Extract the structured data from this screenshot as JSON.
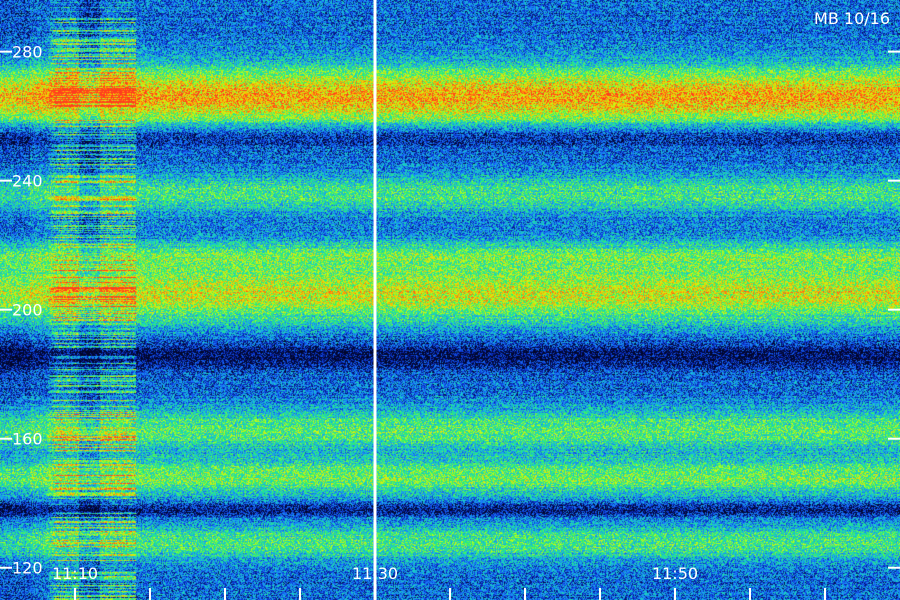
{
  "chart_data": {
    "type": "heatmap",
    "title": "MB 10/16",
    "y_ticks": [
      "120",
      "160",
      "200",
      "240",
      "280"
    ],
    "ylim": [
      110,
      296
    ],
    "x_tick_labels": [
      "11:10",
      "11:30",
      "11:50"
    ],
    "xlim": [
      "11:05",
      "12:05"
    ],
    "x_minor_step_minutes": 5,
    "marker_time": "11:30",
    "colormap": [
      "#02062a",
      "#0a2ecc",
      "#1a7cff",
      "#19d2c8",
      "#2ff06a",
      "#c8ff14",
      "#ffb400",
      "#ff3c1e"
    ],
    "emission_bands": [
      {
        "freq_center": 266,
        "width": 10,
        "strength": 0.62
      },
      {
        "freq_center": 205,
        "width": 9,
        "strength": 0.5
      },
      {
        "freq_center": 236,
        "width": 6,
        "strength": 0.3
      },
      {
        "freq_center": 217,
        "width": 5,
        "strength": 0.28
      },
      {
        "freq_center": 163,
        "width": 7,
        "strength": 0.32
      },
      {
        "freq_center": 148,
        "width": 6,
        "strength": 0.36
      },
      {
        "freq_center": 128,
        "width": 6,
        "strength": 0.3
      }
    ],
    "burst_interval": {
      "start": "11:08",
      "end": "11:14",
      "strength": 0.45
    },
    "dark_bands": [
      {
        "freq_center": 254,
        "width": 4
      },
      {
        "freq_center": 186,
        "width": 4
      },
      {
        "freq_center": 138,
        "width": 2
      }
    ]
  }
}
